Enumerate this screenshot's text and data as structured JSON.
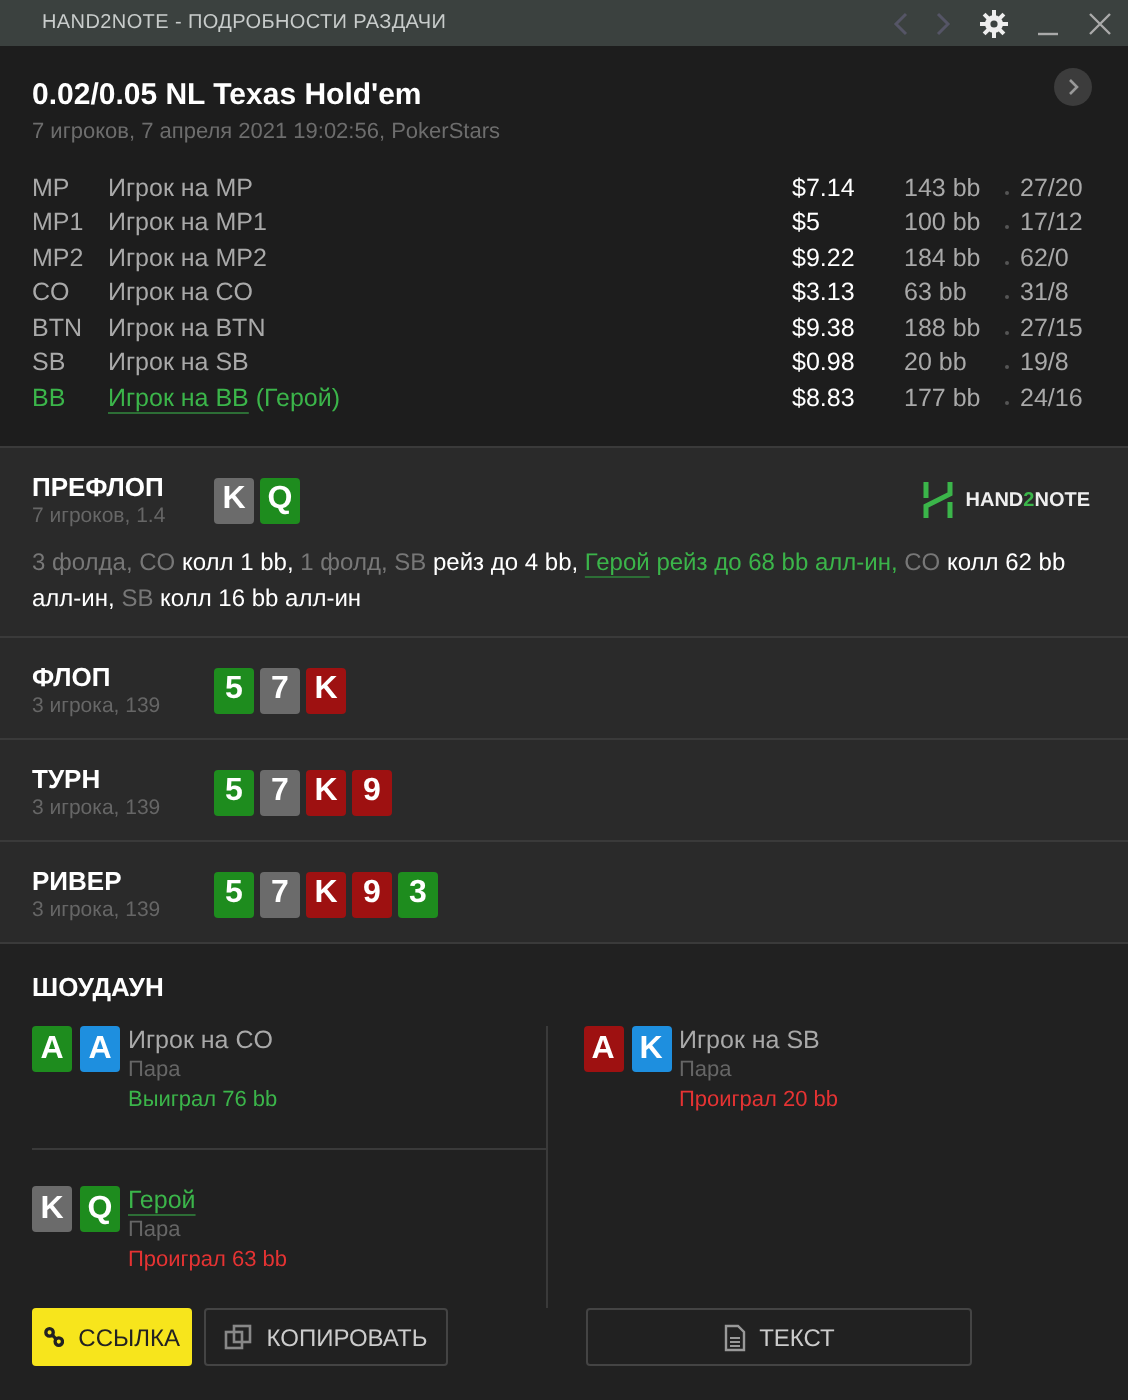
{
  "window": {
    "title": "HAND2NOTE - ПОДРОБНОСТИ РАЗДАЧИ"
  },
  "hand": {
    "title": "0.02/0.05 NL Texas Hold'em",
    "subtitle": "7 игроков, 7 апреля 2021 19:02:56, PokerStars"
  },
  "players": [
    {
      "position": "MP",
      "name": "Игрок на MP",
      "hero": false,
      "stack": "$7.14",
      "bb": "143 bb",
      "stats": "27/20"
    },
    {
      "position": "MP1",
      "name": "Игрок на MP1",
      "hero": false,
      "stack": "$5",
      "bb": "100 bb",
      "stats": "17/12"
    },
    {
      "position": "MP2",
      "name": "Игрок на MP2",
      "hero": false,
      "stack": "$9.22",
      "bb": "184 bb",
      "stats": "62/0"
    },
    {
      "position": "CO",
      "name": "Игрок на CO",
      "hero": false,
      "stack": "$3.13",
      "bb": "63 bb",
      "stats": "31/8"
    },
    {
      "position": "BTN",
      "name": "Игрок на BTN",
      "hero": false,
      "stack": "$9.38",
      "bb": "188 bb",
      "stats": "27/15"
    },
    {
      "position": "SB",
      "name": "Игрок на SB",
      "hero": false,
      "stack": "$0.98",
      "bb": "20 bb",
      "stats": "19/8"
    },
    {
      "position": "BB",
      "name": "Игрок на BB",
      "note": "(Герой)",
      "hero": true,
      "stack": "$8.83",
      "bb": "177 bb",
      "stats": "24/16"
    }
  ],
  "streets": [
    {
      "name": "ПРЕФЛОП",
      "info": "7 игроков, 1.4",
      "cards": [
        {
          "rank": "K",
          "color": "#6b6b6b"
        },
        {
          "rank": "Q",
          "color": "#1e8c1e"
        }
      ],
      "logo": {
        "before": "HAND",
        "accent": "2",
        "after": "NOTE"
      },
      "actions": [
        {
          "kind": "muted",
          "text": "3 фолда, CO"
        },
        {
          "kind": "action",
          "text": "колл 1 bb,"
        },
        {
          "kind": "muted",
          "text": "1 фолд, SB"
        },
        {
          "kind": "action",
          "text": "рейз до 4 bb,"
        },
        {
          "kind": "hero-link",
          "text": "Герой"
        },
        {
          "kind": "hero",
          "text": "рейз до 68 bb алл-ин,"
        },
        {
          "kind": "muted",
          "text": "CO"
        },
        {
          "kind": "action",
          "text": "колл 62 bb алл-ин,"
        },
        {
          "kind": "muted",
          "text": "SB"
        },
        {
          "kind": "action",
          "text": "колл 16 bb алл-ин"
        }
      ]
    },
    {
      "name": "ФЛОП",
      "info": "3 игрока, 139",
      "cards": [
        {
          "rank": "5",
          "color": "#1e8c1e"
        },
        {
          "rank": "7",
          "color": "#6b6b6b"
        },
        {
          "rank": "K",
          "color": "#9e1111"
        }
      ]
    },
    {
      "name": "ТУРН",
      "info": "3 игрока, 139",
      "cards": [
        {
          "rank": "5",
          "color": "#1e8c1e"
        },
        {
          "rank": "7",
          "color": "#6b6b6b"
        },
        {
          "rank": "K",
          "color": "#9e1111"
        },
        {
          "rank": "9",
          "color": "#9e1111"
        }
      ]
    },
    {
      "name": "РИВЕР",
      "info": "3 игрока, 139",
      "cards": [
        {
          "rank": "5",
          "color": "#1e8c1e"
        },
        {
          "rank": "7",
          "color": "#6b6b6b"
        },
        {
          "rank": "K",
          "color": "#9e1111"
        },
        {
          "rank": "9",
          "color": "#9e1111"
        },
        {
          "rank": "3",
          "color": "#1e8c1e"
        }
      ]
    }
  ],
  "showdown": {
    "title": "ШОУДАУН",
    "columns": [
      {
        "entries": [
          {
            "name": "Игрок на CO",
            "hero": false,
            "hand": "Пара",
            "result": "Выиграл 76 bb",
            "won": true,
            "cards": [
              {
                "rank": "A",
                "color": "#1e8c1e"
              },
              {
                "rank": "A",
                "color": "#1e8fdf"
              }
            ]
          },
          {
            "name": "Герой",
            "hero": true,
            "hand": "Пара",
            "result": "Проиграл 63 bb",
            "won": false,
            "cards": [
              {
                "rank": "K",
                "color": "#6b6b6b"
              },
              {
                "rank": "Q",
                "color": "#1e8c1e"
              }
            ]
          }
        ]
      },
      {
        "entries": [
          {
            "name": "Игрок на SB",
            "hero": false,
            "hand": "Пара",
            "result": "Проиграл 20 bb",
            "won": false,
            "cards": [
              {
                "rank": "A",
                "color": "#9e1111"
              },
              {
                "rank": "K",
                "color": "#1e8fdf"
              }
            ]
          }
        ]
      }
    ]
  },
  "buttons": [
    {
      "kind": "link",
      "label": "ССЫЛКА"
    },
    {
      "kind": "copy",
      "label": "КОПИРОВАТЬ"
    },
    {
      "kind": "text",
      "label": "ТЕКСТ"
    }
  ]
}
